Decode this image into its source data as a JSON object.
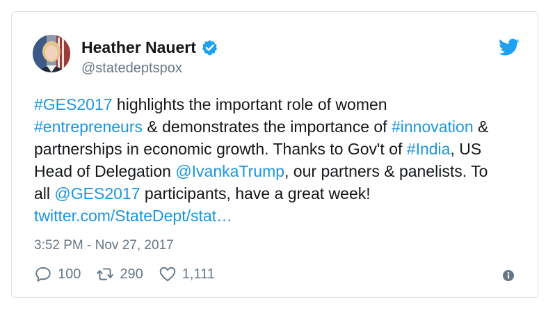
{
  "author": {
    "display_name": "Heather Nauert",
    "handle": "@statedeptspox",
    "verified": true
  },
  "tweet": {
    "lines": [
      [
        {
          "text": "#GES2017",
          "link": true
        },
        {
          "text": " highlights the important role of women",
          "link": false
        }
      ],
      [
        {
          "text": "#entrepreneurs",
          "link": true
        },
        {
          "text": " & demonstrates the importance of ",
          "link": false
        },
        {
          "text": "#innovation",
          "link": true
        },
        {
          "text": " &",
          "link": false
        }
      ],
      [
        {
          "text": "partnerships in economic growth. Thanks to Gov't of ",
          "link": false
        },
        {
          "text": "#India",
          "link": true
        },
        {
          "text": ", US",
          "link": false
        }
      ],
      [
        {
          "text": "Head of Delegation ",
          "link": false
        },
        {
          "text": "@IvankaTrump",
          "link": true
        },
        {
          "text": ", our partners & panelists. To",
          "link": false
        }
      ],
      [
        {
          "text": "all ",
          "link": false
        },
        {
          "text": "@GES2017",
          "link": true
        },
        {
          "text": " participants, have a great week!",
          "link": false
        }
      ],
      [
        {
          "text": "twitter.com/StateDept/stat…",
          "link": true
        }
      ]
    ],
    "timestamp": "3:52 PM - Nov 27, 2017"
  },
  "actions": {
    "replies": "100",
    "retweets": "290",
    "likes": "1,111"
  },
  "icons": {
    "brand": "twitter-bird-icon",
    "verified": "verified-badge-icon",
    "reply": "reply-icon",
    "retweet": "retweet-icon",
    "like": "heart-icon",
    "info": "info-icon"
  },
  "colors": {
    "link": "#1b95e0",
    "brand": "#1da1f2",
    "muted": "#657786",
    "text": "#14171a",
    "border": "#dfe3e6"
  }
}
